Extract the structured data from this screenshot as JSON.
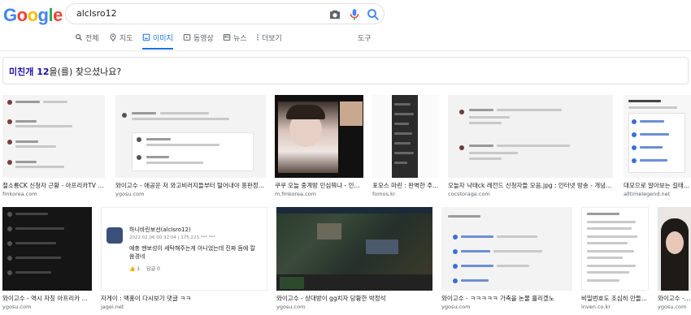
{
  "logo": [
    "G",
    "o",
    "o",
    "g",
    "l",
    "e"
  ],
  "logo_colors": [
    "#4285f4",
    "#ea4335",
    "#fbbc05",
    "#4285f4",
    "#34a853",
    "#ea4335"
  ],
  "search": {
    "query": "alclsro12"
  },
  "tabs": [
    {
      "label": "전체",
      "icon": "search-icon"
    },
    {
      "label": "지도",
      "icon": "map-pin-icon"
    },
    {
      "label": "이미지",
      "icon": "image-icon",
      "active": true
    },
    {
      "label": "동영상",
      "icon": "video-icon"
    },
    {
      "label": "뉴스",
      "icon": "news-icon"
    },
    {
      "label": "더보기",
      "icon": "more-vert-icon"
    }
  ],
  "tools_label": "도구",
  "suggestion": {
    "prefix": "미친개 12",
    "suffix": "을(를) 찾으셨나요?"
  },
  "results": [
    {
      "caption": "철소룡CK 신청자 근황 - 아프리카TV - ...",
      "source": "fmkorea.com"
    },
    {
      "caption": "와이고수 - 애공운 저 와고비러지들부터 털어내야 흥판정...",
      "source": "ygosu.com"
    },
    {
      "caption": "쿠쿠 오늘 중계방 민심뭐냐 - 인...",
      "source": "m.fmkorea.com"
    },
    {
      "caption": "포모스 마린 : 완벽한 주...",
      "source": "fomos.kr"
    },
    {
      "caption": "오늘자 낙태ck 레전드 신청자들 모음.jpg : 인터넷 방송 - 개념글 ...",
      "source": "cocstorage.com"
    },
    {
      "caption": "대모으로 알아보는 길태...",
      "source": "alltimelegend.net"
    },
    {
      "caption": "와이고수 - 역시 자칭 아프리카 대...",
      "source": "ygosu.com"
    },
    {
      "caption": "자게이 : 맥풍이 다시보기 댓글 ㅋㅋ",
      "source": "jagei.net"
    },
    {
      "caption": "와이고수 - 상대방이 gg치자 당황한 박정석",
      "source": "ygosu.com"
    },
    {
      "caption": "와이고수 - ㅋㅋㅋㅋㅋ 가축을 논물 흘리겠노",
      "source": "ygosu.com"
    },
    {
      "caption": "비밀번호도 조심히 만들...",
      "source": "inven.co.kr"
    },
    {
      "caption": "와이고수 - 하...",
      "source": "ygosu.com"
    }
  ],
  "jagei_thumb": {
    "title": "하니바린보선(alclsro12)",
    "meta": "2022.02.06 00:32:04  |  175.223.***.***",
    "body": "예충 멘보성이 세탁해주는게 아니었는데 진짜 듬에 칼씀경네",
    "likes": "1",
    "reply": "답글 0"
  }
}
